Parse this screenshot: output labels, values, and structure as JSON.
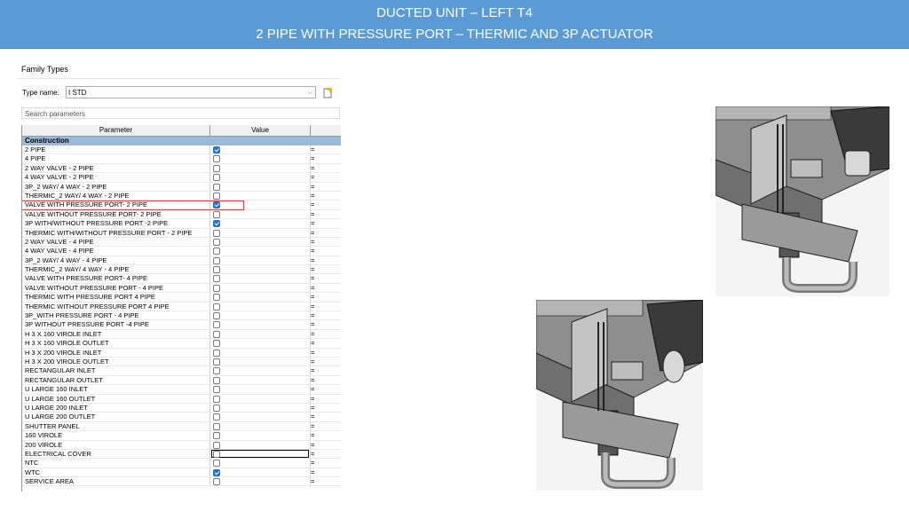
{
  "header": {
    "title_line1": "DUCTED UNIT – LEFT T4",
    "title_line2": "2 PIPE WITH PRESSURE PORT – THERMIC AND 3P ACTUATOR"
  },
  "dialog": {
    "title": "Family Types",
    "type_name_label": "Type name:",
    "type_name_value": "I STD",
    "search_placeholder": "Search parameters",
    "columns": {
      "parameter": "Parameter",
      "value": "Value"
    },
    "group": "Construction",
    "rows": [
      {
        "label": "2 PIPE",
        "checked": true
      },
      {
        "label": "4 PIPE",
        "checked": false
      },
      {
        "label": "2 WAY  VALVE - 2 PIPE",
        "checked": false
      },
      {
        "label": "4 WAY VALVE - 2 PIPE",
        "checked": false
      },
      {
        "label": "3P_2 WAY/ 4 WAY - 2 PIPE",
        "checked": false
      },
      {
        "label": "THERMIC_2 WAY/ 4 WAY - 2 PIPE",
        "checked": false
      },
      {
        "label": "VALVE WITH PRESSURE PORT- 2 PIPE",
        "checked": true,
        "highlight": true
      },
      {
        "label": "VALVE WITHOUT PRESSURE PORT- 2  PIPE",
        "checked": false
      },
      {
        "label": "3P WITH/WITHOUT PRESSURE PORT -2 PIPE",
        "checked": true
      },
      {
        "label": "THERMIC WITH/WITHOUT PRESSURE PORT - 2 PIPE",
        "checked": false
      },
      {
        "label": "2 WAY VALVE - 4 PIPE",
        "checked": false
      },
      {
        "label": "4 WAY VALVE - 4 PIPE",
        "checked": false
      },
      {
        "label": "3P_2 WAY/ 4 WAY - 4 PIPE",
        "checked": false
      },
      {
        "label": "THERMIC_2 WAY/ 4 WAY - 4 PIPE",
        "checked": false
      },
      {
        "label": "VALVE WITH PRESSURE PORT- 4 PIPE",
        "checked": false
      },
      {
        "label": "VALVE WITHOUT PRESSURE PORT - 4 PIPE",
        "checked": false
      },
      {
        "label": "THERMIC WITH PRESSURE PORT 4 PIPE",
        "checked": false
      },
      {
        "label": "THERMIC WITHOUT PRESSURE PORT  4 PIPE",
        "checked": false
      },
      {
        "label": "3P_WITH PRESSURE PORT - 4 PIPE",
        "checked": false
      },
      {
        "label": "3P WITHOUT PRESSURE PORT -4  PIPE",
        "checked": false
      },
      {
        "label": "H  3 X 160 VIROLE INLET",
        "checked": false
      },
      {
        "label": "H  3 X 160 VIROLE OUTLET",
        "checked": false
      },
      {
        "label": "H  3 X 200 VIROLE INLET",
        "checked": false
      },
      {
        "label": "H  3 X 200 VIROLE OUTLET",
        "checked": false
      },
      {
        "label": "RECTANGULAR INLET",
        "checked": false
      },
      {
        "label": "RECTANGULAR OUTLET",
        "checked": false
      },
      {
        "label": "U LARGE 160 INLET",
        "checked": false
      },
      {
        "label": "U LARGE 160 OUTLET",
        "checked": false
      },
      {
        "label": "U LARGE 200 INLET",
        "checked": false
      },
      {
        "label": "U LARGE 200 OUTLET",
        "checked": false
      },
      {
        "label": "SHUTTER PANEL",
        "checked": false
      },
      {
        "label": "160 VIROLE",
        "checked": false
      },
      {
        "label": "200 VIROLE",
        "checked": false
      },
      {
        "label": "ELECTRICAL COVER",
        "checked": false,
        "editing": true
      },
      {
        "label": "NTC",
        "checked": false
      },
      {
        "label": "WTC",
        "checked": true
      },
      {
        "label": "SERVICE AREA",
        "checked": false
      }
    ],
    "eq_symbol": "="
  }
}
